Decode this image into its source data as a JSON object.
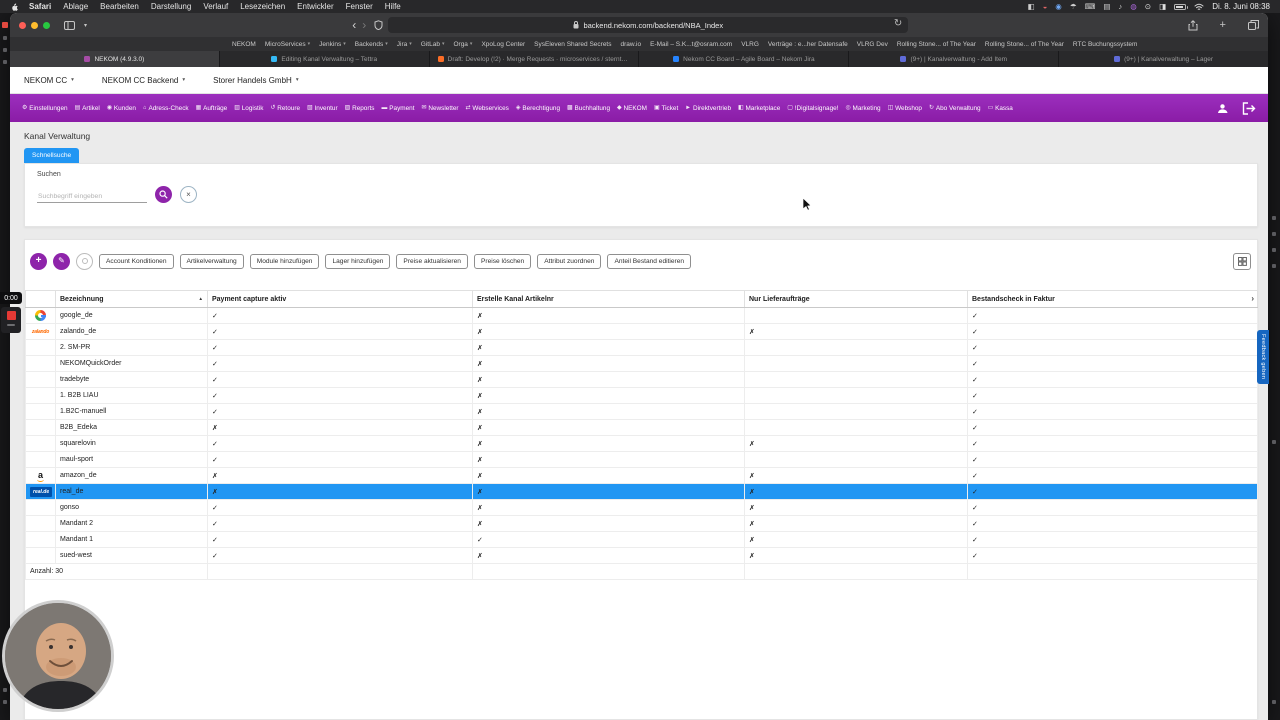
{
  "colors": {
    "accent": "#8e24aa",
    "blue": "#2196f3",
    "row_highlight": "#2196f3"
  },
  "menubar": {
    "items": [
      "Safari",
      "Ablage",
      "Bearbeiten",
      "Darstellung",
      "Verlauf",
      "Lesezeichen",
      "Entwickler",
      "Fenster",
      "Hilfe"
    ],
    "status_icons": [
      {
        "name": "screen-mirroring-icon",
        "glyph": "◧",
        "color": "#cfcfcf"
      },
      {
        "name": "color-app-icon",
        "glyph": "◒",
        "color": "#e06666"
      },
      {
        "name": "password-manager-icon",
        "glyph": "◉",
        "color": "#6fa8f5"
      },
      {
        "name": "vpn-umbrella-icon",
        "glyph": "☂",
        "color": "#cfcfcf"
      },
      {
        "name": "keyboard-icon",
        "glyph": "⌨",
        "color": "#cfcfcf"
      },
      {
        "name": "stats-icon",
        "glyph": "▤",
        "color": "#cfcfcf"
      },
      {
        "name": "sound-icon",
        "glyph": "♪",
        "color": "#cfcfcf"
      },
      {
        "name": "siri-icon",
        "glyph": "◍",
        "color": "#b06ae0"
      },
      {
        "name": "spotlight-icon",
        "glyph": "⊙",
        "color": "#e0e0e0"
      },
      {
        "name": "control-center-icon",
        "glyph": "◨",
        "color": "#e0e0e0"
      }
    ],
    "clock": "Di. 8. Juni 08:38"
  },
  "browser": {
    "url": "backend.nekom.com/backend/NBA_Index",
    "bookmarks": [
      {
        "label": "NEKOM",
        "has_menu": false
      },
      {
        "label": "MicroServices",
        "has_menu": true
      },
      {
        "label": "Jenkins",
        "has_menu": true
      },
      {
        "label": "Backends",
        "has_menu": true
      },
      {
        "label": "Jira",
        "has_menu": true
      },
      {
        "label": "GitLab",
        "has_menu": true
      },
      {
        "label": "Orga",
        "has_menu": true
      },
      {
        "label": "XpoLog Center",
        "has_menu": false
      },
      {
        "label": "SysEleven Shared Secrets",
        "has_menu": false
      },
      {
        "label": "draw.io",
        "has_menu": false
      },
      {
        "label": "E-Mail – S.K...t@osram.com",
        "has_menu": false
      },
      {
        "label": "VLRG",
        "has_menu": false
      },
      {
        "label": "Verträge : e...her Datensafe",
        "has_menu": false
      },
      {
        "label": "VLRG Dev",
        "has_menu": false
      },
      {
        "label": "Rolling Stone... of The Year",
        "has_menu": false
      },
      {
        "label": "Rolling Stone... of The Year",
        "has_menu": false
      },
      {
        "label": "RTC Buchungssystem",
        "has_menu": false
      }
    ],
    "tabs": [
      {
        "label": "NEKOM (4.9.3.0)",
        "favicon": "#a64ca6",
        "active": true
      },
      {
        "label": "Editing Kanal Verwaltung – Tettra",
        "favicon": "#35baf6",
        "active": false
      },
      {
        "label": "Draft: Develop (!2) · Merge Requests · microservices / sterntaler ...",
        "favicon": "#fc6d26",
        "active": false
      },
      {
        "label": "Nekom CC Board – Agile Board – Nekom Jira",
        "favicon": "#2684ff",
        "active": false
      },
      {
        "label": "(9+) | Kanalverwaltung - Add Item",
        "favicon": "#5f6bd8",
        "active": false
      },
      {
        "label": "(9+) | Kanalverwaltung – Lager",
        "favicon": "#5f6bd8",
        "active": false
      }
    ]
  },
  "app": {
    "selectors": [
      "NEKOM CC",
      "NEKOM CC Backend",
      "Storer Handels GmbH"
    ],
    "nav": [
      {
        "icon": "⚙",
        "label": "Einstellungen"
      },
      {
        "icon": "▤",
        "label": "Artikel"
      },
      {
        "icon": "◉",
        "label": "Kunden"
      },
      {
        "icon": "⌂",
        "label": "Adress-Check"
      },
      {
        "icon": "▦",
        "label": "Aufträge"
      },
      {
        "icon": "▥",
        "label": "Logistik"
      },
      {
        "icon": "↺",
        "label": "Retoure"
      },
      {
        "icon": "▧",
        "label": "Inventur"
      },
      {
        "icon": "▨",
        "label": "Reports"
      },
      {
        "icon": "▬",
        "label": "Payment"
      },
      {
        "icon": "✉",
        "label": "Newsletter"
      },
      {
        "icon": "⇄",
        "label": "Webservices"
      },
      {
        "icon": "◈",
        "label": "Berechtigung"
      },
      {
        "icon": "▩",
        "label": "Buchhaltung"
      },
      {
        "icon": "◆",
        "label": "NEKOM"
      },
      {
        "icon": "▣",
        "label": "Ticket"
      },
      {
        "icon": "►",
        "label": "Direktvertrieb"
      },
      {
        "icon": "◧",
        "label": "Marketplace"
      },
      {
        "icon": "▢",
        "label": "!Digitalsignage!"
      },
      {
        "icon": "◎",
        "label": "Marketing"
      },
      {
        "icon": "◫",
        "label": "Webshop"
      },
      {
        "icon": "↻",
        "label": "Abo Verwaltung"
      },
      {
        "icon": "▭",
        "label": "Kassa"
      }
    ],
    "page": {
      "title": "Kanal Verwaltung",
      "quick_tab": "Schnellsuche",
      "search_label": "Suchen",
      "search_placeholder": "Suchbegriff eingeben"
    },
    "actions": [
      "Account Konditionen",
      "Artikelverwaltung",
      "Module hinzufügen",
      "Lager hinzufügen",
      "Preise aktualisieren",
      "Preise löschen",
      "Attribut zuordnen",
      "Anteil Bestand editieren"
    ],
    "table": {
      "columns": [
        "Bezeichnung",
        "Payment capture aktiv",
        "Erstelle Kanal Artikelnr",
        "Nur Lieferaufträge",
        "Bestandscheck in Faktur"
      ],
      "rows": [
        {
          "logo": "google",
          "name": "google_de",
          "values": [
            "✓",
            "✗",
            "",
            "✓"
          ],
          "highlight": false
        },
        {
          "logo": "zalando",
          "name": "zalando_de",
          "values": [
            "✓",
            "✗",
            "✗",
            "✓"
          ],
          "highlight": false
        },
        {
          "logo": "",
          "name": "2. SM-PR",
          "values": [
            "✓",
            "✗",
            "",
            "✓"
          ],
          "highlight": false
        },
        {
          "logo": "",
          "name": "NEKOMQuickOrder",
          "values": [
            "✓",
            "✗",
            "",
            "✓"
          ],
          "highlight": false
        },
        {
          "logo": "",
          "name": "tradebyte",
          "values": [
            "✓",
            "✗",
            "",
            "✓"
          ],
          "highlight": false
        },
        {
          "logo": "",
          "name": "1. B2B LIAU",
          "values": [
            "✓",
            "✗",
            "",
            "✓"
          ],
          "highlight": false
        },
        {
          "logo": "",
          "name": "1.B2C-manuell",
          "values": [
            "✓",
            "✗",
            "",
            "✓"
          ],
          "highlight": false
        },
        {
          "logo": "",
          "name": "B2B_Edeka",
          "values": [
            "✗",
            "✗",
            "",
            "✓"
          ],
          "highlight": false
        },
        {
          "logo": "",
          "name": "squarelovin",
          "values": [
            "✓",
            "✗",
            "✗",
            "✓"
          ],
          "highlight": false
        },
        {
          "logo": "",
          "name": "maul-sport",
          "values": [
            "✓",
            "✗",
            "",
            "✓"
          ],
          "highlight": false
        },
        {
          "logo": "amazon",
          "name": "amazon_de",
          "values": [
            "✗",
            "✗",
            "✗",
            "✓"
          ],
          "highlight": false
        },
        {
          "logo": "real",
          "name": "real_de",
          "values": [
            "✗",
            "✗",
            "✗",
            "✓"
          ],
          "highlight": true
        },
        {
          "logo": "",
          "name": "gonso",
          "values": [
            "✓",
            "✗",
            "✗",
            "✓"
          ],
          "highlight": false
        },
        {
          "logo": "",
          "name": "Mandant 2",
          "values": [
            "✓",
            "✗",
            "✗",
            "✓"
          ],
          "highlight": false
        },
        {
          "logo": "",
          "name": "Mandant 1",
          "values": [
            "✓",
            "✓",
            "✗",
            "✓"
          ],
          "highlight": false
        },
        {
          "logo": "",
          "name": "sued-west",
          "values": [
            "✓",
            "✗",
            "✗",
            "✓"
          ],
          "highlight": false
        }
      ],
      "footer": "Anzahl: 30"
    }
  },
  "overlay": {
    "timer": "0:00",
    "feedback": "Feedback geben"
  }
}
